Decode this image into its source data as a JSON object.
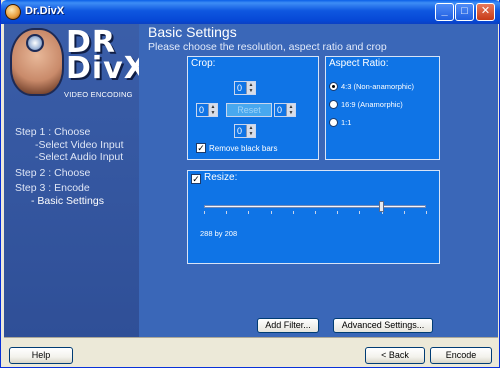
{
  "window": {
    "title": "Dr.DivX"
  },
  "logo": {
    "line1": "DR",
    "line2": "DivX",
    "tagline": "VIDEO ENCODING"
  },
  "steps": {
    "step1": "Step 1 : Choose",
    "step1_sub1": "-Select Video Input",
    "step1_sub2": "-Select Audio Input",
    "step2": "Step 2 : Choose",
    "step3": "Step 3 : Encode",
    "step3_sub1": "- Basic Settings"
  },
  "main": {
    "title": "Basic Settings",
    "subtitle": "Please choose the resolution, aspect ratio and crop"
  },
  "crop": {
    "title": "Crop:",
    "top": "0",
    "left": "0",
    "right": "0",
    "bottom": "0",
    "reset_label": "Reset",
    "remove_black_bars_label": "Remove black bars",
    "remove_black_bars_checked": true
  },
  "aspect": {
    "title": "Aspect Ratio:",
    "options": [
      "4:3 (Non-anamorphic)",
      "16:9 (Anamorphic)",
      "1:1"
    ],
    "selected": "4:3 (Non-anamorphic)"
  },
  "resize": {
    "title": "Resize:",
    "checked": true,
    "value_label": "288 by 208",
    "slider_fraction": 0.8
  },
  "buttons": {
    "add_filter": "Add Filter...",
    "advanced_settings": "Advanced Settings..."
  },
  "bottom": {
    "help": "Help",
    "back": "< Back",
    "encode": "Encode"
  },
  "colors": {
    "titlebar": "#0a5fe8",
    "left_panel": "#3a5ea9",
    "main_panel": "#3a67b8",
    "group_box": "#0f74e6"
  }
}
